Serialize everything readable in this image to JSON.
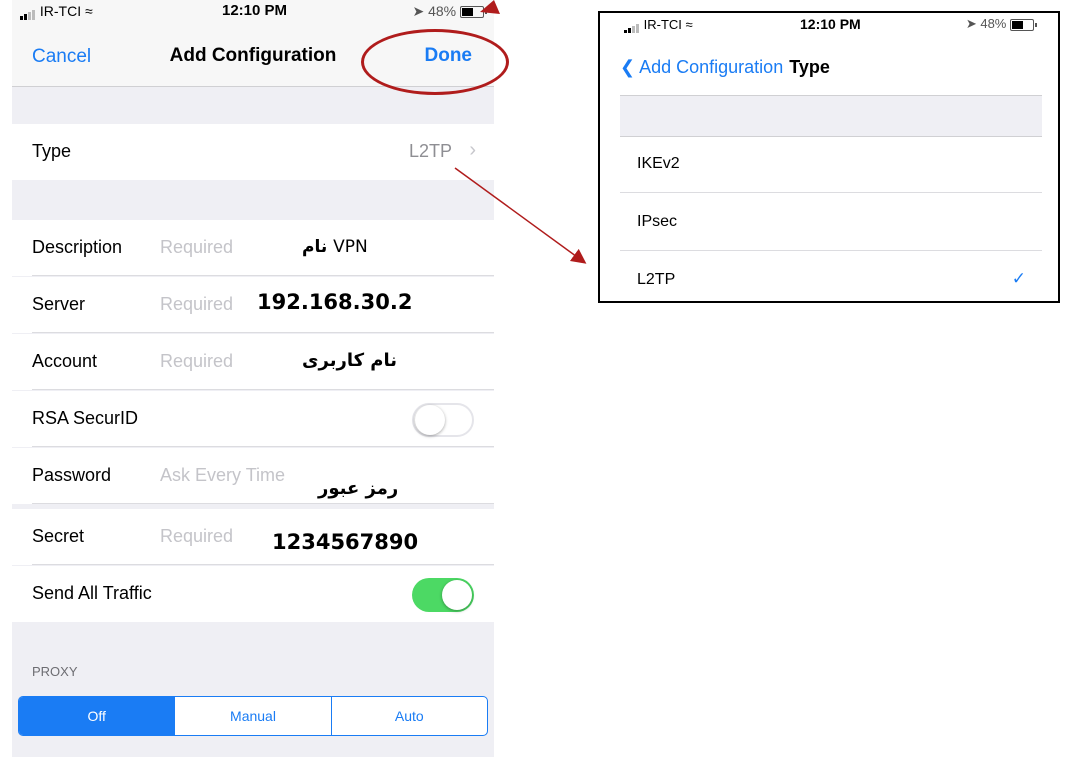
{
  "colors": {
    "accent": "#1a7cf4",
    "toggle_on": "#4cd964",
    "annotation_red": "#b01c1c"
  },
  "status_bar": {
    "carrier": "IR-TCI",
    "time": "12:10 PM",
    "battery": "48%"
  },
  "nav": {
    "cancel": "Cancel",
    "title": "Add Configuration",
    "done": "Done"
  },
  "fields": {
    "type": {
      "label": "Type",
      "value": "L2TP",
      "chevron": "chevron-right-icon"
    },
    "description": {
      "label": "Description",
      "placeholder": "Required"
    },
    "server": {
      "label": "Server",
      "placeholder": "Required"
    },
    "account": {
      "label": "Account",
      "placeholder": "Required"
    },
    "rsa": {
      "label": "RSA SecurID",
      "on": false
    },
    "password": {
      "label": "Password",
      "placeholder": "Ask Every Time"
    },
    "secret": {
      "label": "Secret",
      "placeholder": "Required"
    },
    "send_all_traffic": {
      "label": "Send All Traffic",
      "on": true
    }
  },
  "annotations": {
    "description_a": "نام",
    "description_b": "VPN",
    "server": "192.168.30.2",
    "account": "نام کاربری",
    "password": "رمز عبور",
    "secret": "1234567890"
  },
  "proxy": {
    "header": "PROXY",
    "options": [
      "Off",
      "Manual",
      "Auto"
    ],
    "selected": "Off"
  },
  "type_panel": {
    "status_bar": {
      "carrier": "IR-TCI",
      "time": "12:10 PM",
      "battery": "48%"
    },
    "back_label": "Add Configuration",
    "title": "Type",
    "options": [
      "IKEv2",
      "IPsec",
      "L2TP"
    ],
    "selected": "L2TP",
    "check": "✓"
  }
}
